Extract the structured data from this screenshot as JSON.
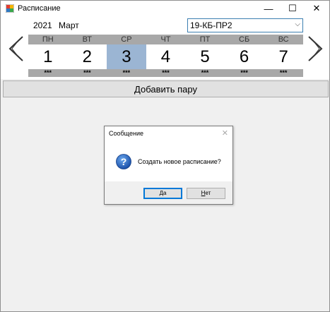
{
  "window": {
    "title": "Расписание",
    "minimize": "—",
    "maximize": "☐",
    "close": "✕"
  },
  "header": {
    "year": "2021",
    "month": "Март",
    "group": "19-КБ-ПР2"
  },
  "week": {
    "days": [
      {
        "name": "ПН",
        "num": "1",
        "stars": "***"
      },
      {
        "name": "ВТ",
        "num": "2",
        "stars": "***"
      },
      {
        "name": "СР",
        "num": "3",
        "stars": "***"
      },
      {
        "name": "ЧТ",
        "num": "4",
        "stars": "***"
      },
      {
        "name": "ПТ",
        "num": "5",
        "stars": "***"
      },
      {
        "name": "СБ",
        "num": "6",
        "stars": "***"
      },
      {
        "name": "ВС",
        "num": "7",
        "stars": "***"
      }
    ],
    "selected_day": "3"
  },
  "toolbar": {
    "add_pair": "Добавить пару"
  },
  "dialog": {
    "title": "Сообщение",
    "close": "✕",
    "message": "Создать новое расписание?",
    "yes_first": "Д",
    "yes_rest": "а",
    "no_first": "Н",
    "no_rest": "ет",
    "icon": "question-icon"
  },
  "colors": {
    "selected_day": "#9bb5d3",
    "strip": "#a8a8a8",
    "focus": "#0078d7"
  }
}
